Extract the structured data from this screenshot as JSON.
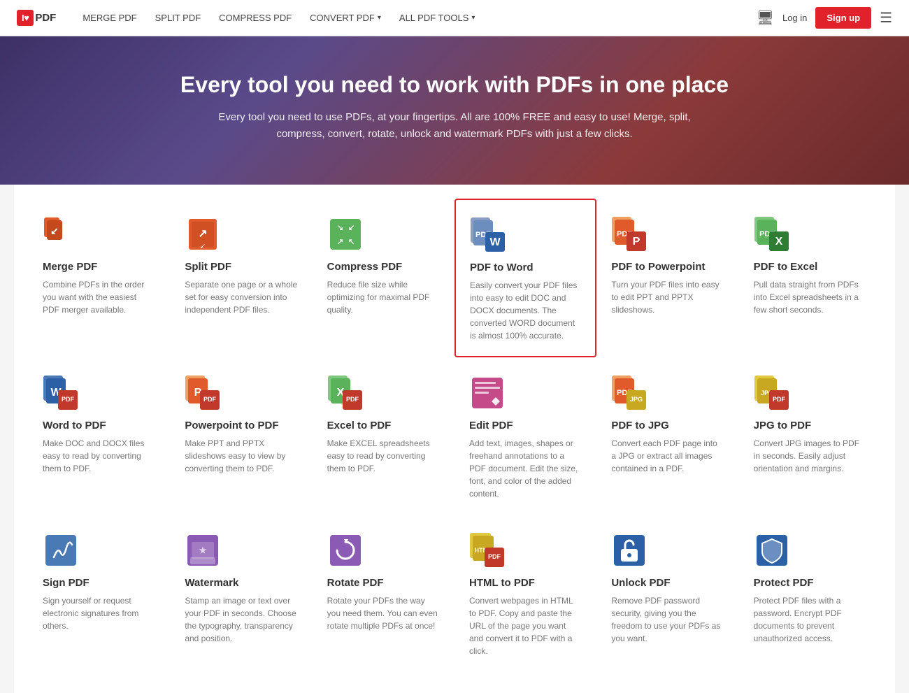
{
  "nav": {
    "logo_heart": "I♥",
    "logo_pdf": "PDF",
    "links": [
      {
        "id": "merge-pdf",
        "label": "MERGE PDF",
        "has_dropdown": false
      },
      {
        "id": "split-pdf",
        "label": "SPLIT PDF",
        "has_dropdown": false
      },
      {
        "id": "compress-pdf",
        "label": "COMPRESS PDF",
        "has_dropdown": false
      },
      {
        "id": "convert-pdf",
        "label": "CONVERT PDF",
        "has_dropdown": true
      },
      {
        "id": "all-pdf-tools",
        "label": "ALL PDF TOOLS",
        "has_dropdown": true
      }
    ],
    "login_label": "Log in",
    "signup_label": "Sign up"
  },
  "hero": {
    "title": "Every tool you need to work with PDFs in one place",
    "subtitle": "Every tool you need to use PDFs, at your fingertips. All are 100% FREE and easy to use! Merge, split, compress, convert, rotate, unlock and watermark PDFs with just a few clicks."
  },
  "tools": [
    {
      "id": "merge-pdf",
      "name": "Merge PDF",
      "desc": "Combine PDFs in the order you want with the easiest PDF merger available.",
      "highlighted": false,
      "icon_color_bg": "#e05a2b",
      "icon_color_accent": "#c44a1e",
      "icon_type": "merge"
    },
    {
      "id": "split-pdf",
      "name": "Split PDF",
      "desc": "Separate one page or a whole set for easy conversion into independent PDF files.",
      "highlighted": false,
      "icon_color_bg": "#e05a2b",
      "icon_color_accent": "#c44a1e",
      "icon_type": "split"
    },
    {
      "id": "compress-pdf",
      "name": "Compress PDF",
      "desc": "Reduce file size while optimizing for maximal PDF quality.",
      "highlighted": false,
      "icon_color_bg": "#5ab25a",
      "icon_color_accent": "#4a9a4a",
      "icon_type": "compress"
    },
    {
      "id": "pdf-to-word",
      "name": "PDF to Word",
      "desc": "Easily convert your PDF files into easy to edit DOC and DOCX documents. The converted WORD document is almost 100% accurate.",
      "highlighted": true,
      "icon_color_bg": "#6c8ebf",
      "icon_color_accent": "#2b5fa6",
      "icon_type": "pdf-to-word"
    },
    {
      "id": "pdf-to-powerpoint",
      "name": "PDF to Powerpoint",
      "desc": "Turn your PDF files into easy to edit PPT and PPTX slideshows.",
      "highlighted": false,
      "icon_color_bg": "#e05a2b",
      "icon_color_accent": "#c44a1e",
      "icon_type": "pdf-to-ppt"
    },
    {
      "id": "pdf-to-excel",
      "name": "PDF to Excel",
      "desc": "Pull data straight from PDFs into Excel spreadsheets in a few short seconds.",
      "highlighted": false,
      "icon_color_bg": "#5ab25a",
      "icon_color_accent": "#4a9a4a",
      "icon_type": "pdf-to-excel"
    },
    {
      "id": "word-to-pdf",
      "name": "Word to PDF",
      "desc": "Make DOC and DOCX files easy to read by converting them to PDF.",
      "highlighted": false,
      "icon_color_bg": "#2b5fa6",
      "icon_color_accent": "#1a4a8a",
      "icon_type": "word-to-pdf"
    },
    {
      "id": "powerpoint-to-pdf",
      "name": "Powerpoint to PDF",
      "desc": "Make PPT and PPTX slideshows easy to view by converting them to PDF.",
      "highlighted": false,
      "icon_color_bg": "#e05a2b",
      "icon_color_accent": "#c44a1e",
      "icon_type": "ppt-to-pdf"
    },
    {
      "id": "excel-to-pdf",
      "name": "Excel to PDF",
      "desc": "Make EXCEL spreadsheets easy to read by converting them to PDF.",
      "highlighted": false,
      "icon_color_bg": "#5ab25a",
      "icon_color_accent": "#4a9a4a",
      "icon_type": "excel-to-pdf"
    },
    {
      "id": "edit-pdf",
      "name": "Edit PDF",
      "desc": "Add text, images, shapes or freehand annotations to a PDF document. Edit the size, font, and color of the added content.",
      "highlighted": false,
      "icon_color_bg": "#c44a8a",
      "icon_color_accent": "#a03070",
      "icon_type": "edit"
    },
    {
      "id": "pdf-to-jpg",
      "name": "PDF to JPG",
      "desc": "Convert each PDF page into a JPG or extract all images contained in a PDF.",
      "highlighted": false,
      "icon_color_bg": "#e05a2b",
      "icon_color_accent": "#c44a1e",
      "icon_type": "pdf-to-jpg"
    },
    {
      "id": "jpg-to-pdf",
      "name": "JPG to PDF",
      "desc": "Convert JPG images to PDF in seconds. Easily adjust orientation and margins.",
      "highlighted": false,
      "icon_color_bg": "#c8a820",
      "icon_color_accent": "#a88a10",
      "icon_type": "jpg-to-pdf"
    },
    {
      "id": "sign-pdf",
      "name": "Sign PDF",
      "desc": "Sign yourself or request electronic signatures from others.",
      "highlighted": false,
      "icon_color_bg": "#4a7ab5",
      "icon_color_accent": "#2b5fa6",
      "icon_type": "sign"
    },
    {
      "id": "watermark",
      "name": "Watermark",
      "desc": "Stamp an image or text over your PDF in seconds. Choose the typography, transparency and position.",
      "highlighted": false,
      "icon_color_bg": "#8b5ab5",
      "icon_color_accent": "#6a3a9a",
      "icon_type": "watermark"
    },
    {
      "id": "rotate-pdf",
      "name": "Rotate PDF",
      "desc": "Rotate your PDFs the way you need them. You can even rotate multiple PDFs at once!",
      "highlighted": false,
      "icon_color_bg": "#8b5ab5",
      "icon_color_accent": "#6a3a9a",
      "icon_type": "rotate"
    },
    {
      "id": "html-to-pdf",
      "name": "HTML to PDF",
      "desc": "Convert webpages in HTML to PDF. Copy and paste the URL of the page you want and convert it to PDF with a click.",
      "highlighted": false,
      "icon_color_bg": "#c8a820",
      "icon_color_accent": "#a88a10",
      "icon_type": "html-to-pdf"
    },
    {
      "id": "unlock-pdf",
      "name": "Unlock PDF",
      "desc": "Remove PDF password security, giving you the freedom to use your PDFs as you want.",
      "highlighted": false,
      "icon_color_bg": "#2b5fa6",
      "icon_color_accent": "#1a4a8a",
      "icon_type": "unlock"
    },
    {
      "id": "protect-pdf",
      "name": "Protect PDF",
      "desc": "Protect PDF files with a password. Encrypt PDF documents to prevent unauthorized access.",
      "highlighted": false,
      "icon_color_bg": "#2b5fa6",
      "icon_color_accent": "#1a4a8a",
      "icon_type": "protect"
    }
  ]
}
